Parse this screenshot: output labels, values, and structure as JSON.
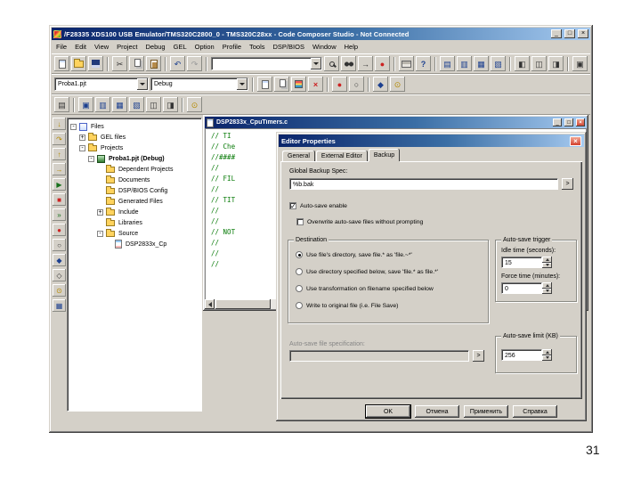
{
  "slide": {
    "page_number": "31"
  },
  "app": {
    "title": "/F28335 XDS100 USB Emulator/TMS320C2800_0 - TMS320C28xx - Code Composer Studio - Not Connected",
    "menu": [
      "File",
      "Edit",
      "View",
      "Project",
      "Debug",
      "GEL",
      "Option",
      "Profile",
      "Tools",
      "DSP/BIOS",
      "Window",
      "Help"
    ],
    "toolbar": {
      "search_value": "",
      "project_combo": "Proba1.pjt",
      "config_combo": "Debug"
    }
  },
  "icons": {
    "minimize": "_",
    "maximize": "□",
    "close": "×",
    "check": "✓",
    "more": ">",
    "cut": "✂",
    "undo": "↶",
    "redo": "↷",
    "help": "?",
    "view_list": "▤",
    "view_cols": "▥",
    "view_grid": "▦",
    "view_mix": "▧",
    "win_split_l": "◧",
    "win_split": "◫",
    "win_split_r": "◨",
    "win_box": "▣",
    "run": "▶",
    "halt": "■",
    "step_into": "↓",
    "step_over": "↷",
    "step_out": "↑",
    "run_to": "→",
    "animate": "»",
    "breakpoint": "●",
    "breakpoint_clear": "○",
    "probe": "◆",
    "probe_clear": "◇",
    "clock": "⊙",
    "memory": "▦",
    "stop_build": "×"
  },
  "tree": {
    "items": [
      {
        "label": "Files",
        "expander": "-"
      },
      {
        "label": "GEL files",
        "expander": "+"
      },
      {
        "label": "Projects",
        "expander": "-"
      },
      {
        "label": "Proba1.pjt (Debug)",
        "expander": "-"
      },
      {
        "label": "Dependent Projects",
        "expander": ""
      },
      {
        "label": "Documents",
        "expander": ""
      },
      {
        "label": "DSP/BIOS Config",
        "expander": ""
      },
      {
        "label": "Generated Files",
        "expander": ""
      },
      {
        "label": "Include",
        "expander": "+"
      },
      {
        "label": "Libraries",
        "expander": ""
      },
      {
        "label": "Source",
        "expander": "-"
      },
      {
        "label": "DSP2833x_Cp",
        "expander": ""
      }
    ]
  },
  "editor": {
    "title": "DSP2833x_CpuTimers.c",
    "code_lines": [
      "// TI",
      "// Che",
      "//####",
      "//",
      "// FIL",
      "//",
      "// TIT",
      "//",
      "//",
      "// NOT",
      "//",
      "//",
      "//"
    ]
  },
  "dialog": {
    "title": "Editor Properties",
    "tabs": [
      "General",
      "External Editor",
      "Backup"
    ],
    "global_backup_label": "Global Backup Spec:",
    "global_backup_value": "%b.bak",
    "autosave_checkbox": "Auto-save enable",
    "overwrite_checkbox": "Overwrite auto-save files without prompting",
    "destination": {
      "title": "Destination",
      "options": [
        "Use file's directory, save file.* as 'file.~*'",
        "Use directory specified below, save 'file.* as file.*'",
        "Use transformation on filename specified below",
        "Write to original file (i.e. File Save)"
      ]
    },
    "trigger": {
      "title": "Auto-save trigger",
      "idle_label": "Idle time (seconds):",
      "idle_value": "15",
      "force_label": "Force time (minutes):",
      "force_value": "0"
    },
    "spec_label": "Auto-save file specification:",
    "spec_value": "",
    "limit": {
      "title": "Auto-save limit (KB)",
      "value": "256"
    },
    "buttons": [
      "OK",
      "Отмена",
      "Применить",
      "Справка"
    ]
  }
}
